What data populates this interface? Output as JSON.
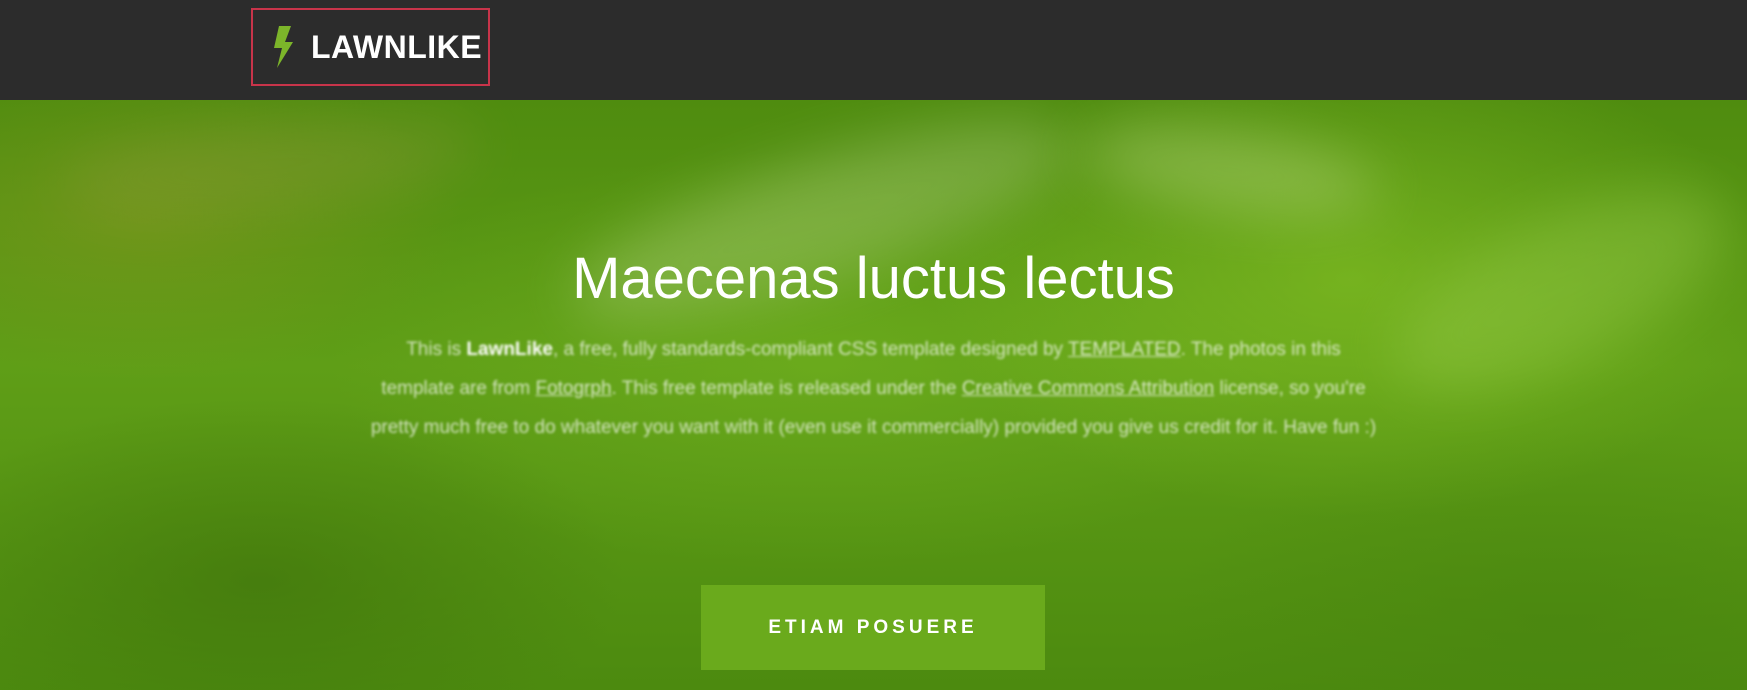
{
  "header": {
    "logo_text": "LAWNLIKE",
    "logo_icon": "lightning-bolt-icon",
    "logo_icon_color": "#7cb52a",
    "logo_border_color": "#c8344a",
    "background": "#2c2c2c"
  },
  "hero": {
    "title": "Maecenas luctus lectus",
    "text": {
      "part1": "This is ",
      "brand": "LawnLike",
      "part2": ", a free, fully standards-compliant CSS template designed by ",
      "link_templated": "TEMPLATED",
      "part3": ". The photos in this template are from ",
      "link_fotogrph": "Fotogrph",
      "part4": ". This free template is released under the ",
      "link_cc": "Creative Commons Attribution",
      "part5": " license, so you're pretty much free to do whatever you want with it (even use it commercially) provided you give us credit for it. Have fun :)"
    },
    "button_label": "ETIAM POSUERE",
    "button_color": "#6aaa1c",
    "background_color": "#5a9a14"
  }
}
